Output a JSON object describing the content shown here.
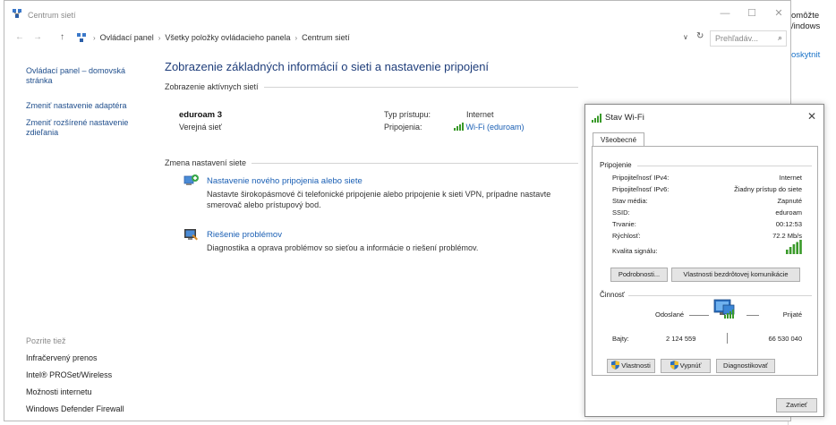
{
  "window": {
    "title": "Centrum sietí",
    "controls": {
      "minimize": "—",
      "maximize": "☐",
      "close": "✕"
    }
  },
  "address_bar": {
    "nav": {
      "back": "←",
      "forward": "→",
      "up": "↑"
    },
    "breadcrumbs": [
      "Ovládací panel",
      "Všetky položky ovládacieho panela",
      "Centrum sietí"
    ],
    "separator": "›",
    "dropdown": "∨",
    "refresh": "↻",
    "search_placeholder": "Prehľadáv...",
    "search_icon": "⌕"
  },
  "left_nav": {
    "home_line1": "Ovládací panel – domovská",
    "home_line2": "stránka",
    "adapter": "Zmeniť nastavenie adaptéra",
    "sharing_line1": "Zmeniť rozšírené nastavenie",
    "sharing_line2": "zdieľania",
    "see_also_label": "Pozrite tiež",
    "see_also": [
      "Infračervený prenos",
      "Intel® PROSet/Wireless",
      "Možnosti internetu",
      "Windows Defender Firewall"
    ]
  },
  "main": {
    "heading": "Zobrazenie základných informácií o sieti a nastavenie pripojení",
    "active_networks_label": "Zobrazenie aktívnych sietí",
    "network": {
      "name": "eduroam 3",
      "type": "Verejná sieť",
      "access_label": "Typ prístupu:",
      "access_value": "Internet",
      "connections_label": "Pripojenia:",
      "connections_value": "Wi-Fi (eduroam)"
    },
    "change_label": "Zmena nastavení siete",
    "tasks": [
      {
        "title": "Nastavenie nového pripojenia alebo siete",
        "desc_line1": "Nastavte širokopásmové či telefonické pripojenie alebo pripojenie k sieti VPN, prípadne nastavte",
        "desc_line2": "smerovač alebo prístupový bod."
      },
      {
        "title": "Riešenie problémov",
        "desc_line1": "Diagnostika a oprava problémov so sieťou a informácie o riešení problémov."
      }
    ]
  },
  "dialog": {
    "title": "Stav Wi-Fi",
    "close": "✕",
    "tab": "Všeobecné",
    "connection_group": "Pripojenie",
    "rows": [
      {
        "label": "Pripojiteľnosť IPv4:",
        "value": "Internet"
      },
      {
        "label": "Pripojiteľnosť IPv6:",
        "value": "Žiadny prístup do siete"
      },
      {
        "label": "Stav média:",
        "value": "Zapnuté"
      },
      {
        "label": "SSID:",
        "value": "eduroam"
      },
      {
        "label": "Trvanie:",
        "value": "00:12:53"
      },
      {
        "label": "Rýchlosť:",
        "value": "72.2 Mb/s"
      }
    ],
    "signal_label": "Kvalita signálu:",
    "btn_details": "Podrobnosti...",
    "btn_wireless": "Vlastnosti bezdrôtovej komunikácie",
    "activity_group": "Činnosť",
    "sent_label": "Odoslané",
    "received_label": "Prijaté",
    "bytes_label": "Bajty:",
    "bytes_sent": "2 124 559",
    "bytes_received": "66 530 040",
    "btn_properties": "Vlastnosti",
    "btn_disable": "Vypnúť",
    "btn_diagnose": "Diagnostikovať",
    "btn_close": "Zavrieť"
  },
  "background_window": {
    "line1": "omôžte",
    "line2": "/indows",
    "link": "oskytnit"
  },
  "colors": {
    "link": "#1a5fb4",
    "heading": "#1e3d7a",
    "signal": "#3a9a2a"
  }
}
